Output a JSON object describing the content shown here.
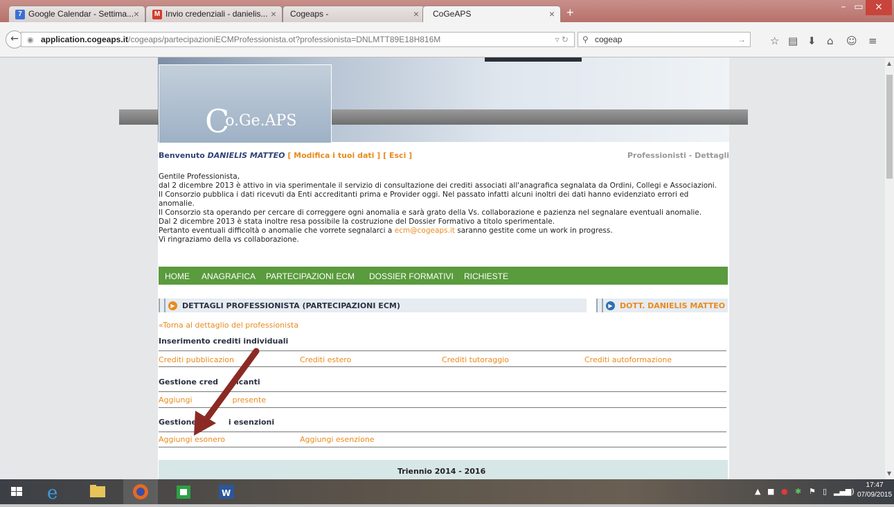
{
  "browser": {
    "tabs": [
      {
        "label": "Google Calendar - Settima...",
        "icon": "calendar-icon",
        "icon_text": "7",
        "color": "#3b6fd6"
      },
      {
        "label": "Invio credenziali - danielis...",
        "icon": "gmail-icon",
        "icon_text": "M",
        "color": "#d33b2c"
      },
      {
        "label": "Cogeaps -",
        "icon": "blank-page-icon",
        "icon_text": "",
        "color": ""
      },
      {
        "label": "CoGeAPS",
        "icon": "blank-page-icon",
        "icon_text": "",
        "color": ""
      }
    ],
    "active_tab": 3,
    "new_tab": "+",
    "url_domain": "application.cogeaps.it",
    "url_prefix": "",
    "url_path": "/cogeaps/partecipazioniECMProfessionista.ot?professionista=DNLMTT89E18H816M",
    "search_value": "cogeap",
    "window_buttons": [
      "–",
      "▭",
      "×"
    ]
  },
  "site": {
    "logo_c": "C",
    "logo_rest": "o.Ge.APS",
    "welcome_prefix": "Benvenuto ",
    "user_name": "DANIELIS MATTEO",
    "modify_link": "[ Modifica i tuoi dati ]",
    "exit_link": "[ Esci ]",
    "section_label": "Professionisti - Dettagli",
    "intro": [
      "Gentile Professionista,",
      "dal 2 dicembre 2013 è attivo in via sperimentale il servizio di consultazione dei crediti associati all'anagrafica segnalata da Ordini, Collegi e Associazioni.",
      "Il Consorzio pubblica i dati ricevuti da Enti accreditanti prima e Provider oggi. Nel passato infatti alcuni inoltri dei dati hanno evidenziato errori ed",
      "anomalie.",
      "Il Consorzio sta operando per cercare di correggere ogni anomalia e sarà grato della Vs. collaborazione e pazienza nel segnalare eventuali anomalie.",
      "Dal 2 dicembre 2013 è stata inoltre resa possibile la costruzione del Dossier Formativo a titolo sperimentale."
    ],
    "intro_line7_before": "Pertanto eventuali difficoltà o anomalie che vorrete segnalarci a ",
    "intro_email": "ecm@cogeaps.it",
    "intro_line7_after": " saranno gestite come un work in progress.",
    "intro_line8": "Vi ringraziamo della vs collaborazione.",
    "menu": [
      "HOME",
      "ANAGRAFICA",
      "PARTECIPAZIONI ECM",
      "DOSSIER FORMATIVI",
      "RICHIESTE"
    ],
    "details_title": "DETTAGLI PROFESSIONISTA (PARTECIPAZIONI ECM)",
    "professional_title": "DOTT. DANIELIS MATTEO",
    "back_link": "«Torna al dettaglio del professionista",
    "sec1_title": "Inserimento crediti individuali",
    "sec1_links": [
      "Crediti pubblicazion",
      "Crediti estero",
      "Crediti tutoraggio",
      "Crediti autoformazione"
    ],
    "sec2_title_a": "Gestione cred",
    "sec2_title_b": "icanti",
    "sec2_link_a": "Aggiungi",
    "sec2_link_b": "presente",
    "sec3_title_a": "Gestione",
    "sec3_title_b": "i esenzioni",
    "sec3_links": [
      "Aggiungi esonero",
      "Aggiungi esenzione"
    ],
    "triennio": "Triennio 2014 - 2016"
  },
  "taskbar": {
    "time": "17:47",
    "date": "07/09/2015"
  },
  "colors": {
    "accent_orange": "#e98a1e",
    "menu_green": "#5a9b3d",
    "title_navy": "#2f4376",
    "arrow_red": "#8b2a24"
  }
}
